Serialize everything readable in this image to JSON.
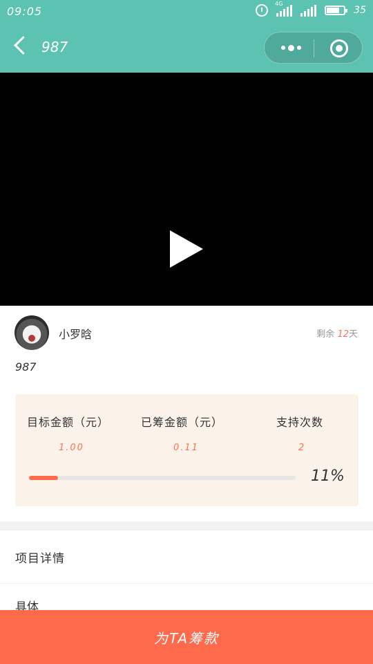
{
  "status_bar": {
    "time": "09:05",
    "network": "4G",
    "battery": "35"
  },
  "nav": {
    "title": "987"
  },
  "video": {
    "play_icon": "play-icon"
  },
  "author": {
    "name": "小罗晗",
    "remaining_prefix": "剩余 ",
    "remaining_days": "12",
    "remaining_suffix": "天"
  },
  "project": {
    "description": "987"
  },
  "stats": {
    "target_label": "目标金额（元）",
    "target_value": "1.00",
    "raised_label": "已筹金额（元）",
    "raised_value": "0.11",
    "supporters_label": "支持次数",
    "supporters_value": "2",
    "progress_percent": 11,
    "progress_text": "11%"
  },
  "details": {
    "title": "项目详情",
    "body": "具体"
  },
  "cta": {
    "label": "为TA筹款"
  },
  "colors": {
    "theme": "#5cc2b1",
    "accent": "#ff6a4d"
  }
}
